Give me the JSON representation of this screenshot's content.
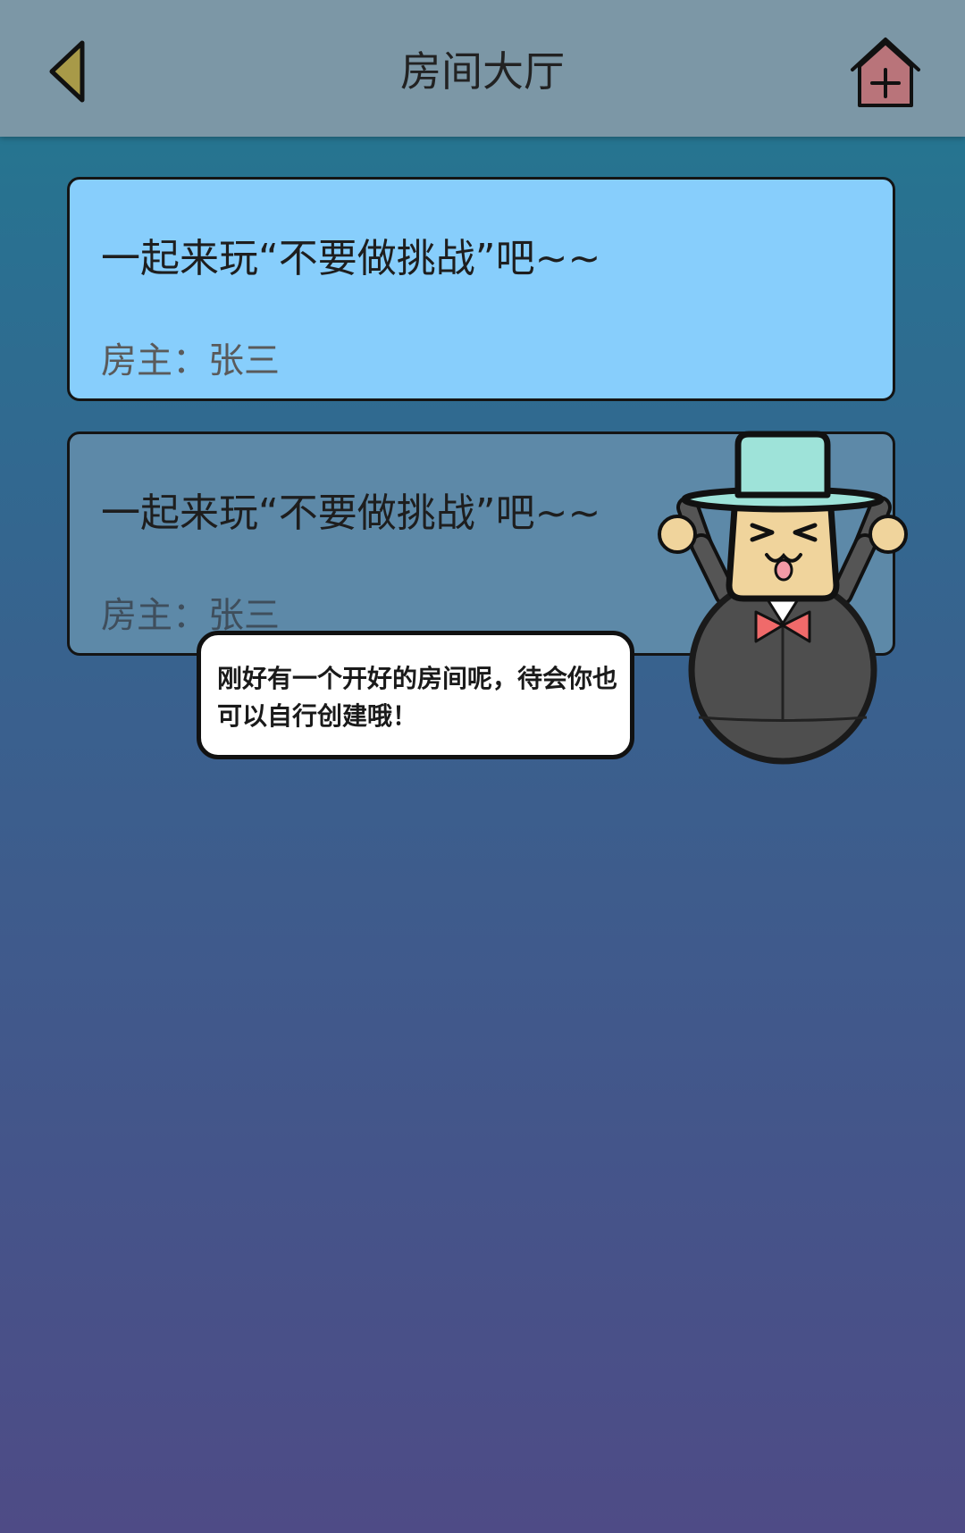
{
  "header": {
    "title": "房间大厅",
    "back_icon": "back-triangle-icon",
    "create_icon": "house-plus-icon"
  },
  "rooms": [
    {
      "title": "一起来玩“不要做挑战”吧~~",
      "owner": "房主：张三",
      "state": "highlighted"
    },
    {
      "title": "一起来玩“不要做挑战”吧~~",
      "owner": "房主：张三",
      "state": "normal"
    }
  ],
  "mascot": {
    "message": "刚好有一个开好的房间呢，待会你也可以自行创建哦！"
  },
  "colors": {
    "header_bg": "#7c97a6",
    "card_active": "#87cefc",
    "card_normal": "#5d89a8",
    "back_icon": "#a89a48",
    "create_icon": "#b9747a",
    "hat": "#9ee3d9",
    "bow": "#f06a6a"
  }
}
